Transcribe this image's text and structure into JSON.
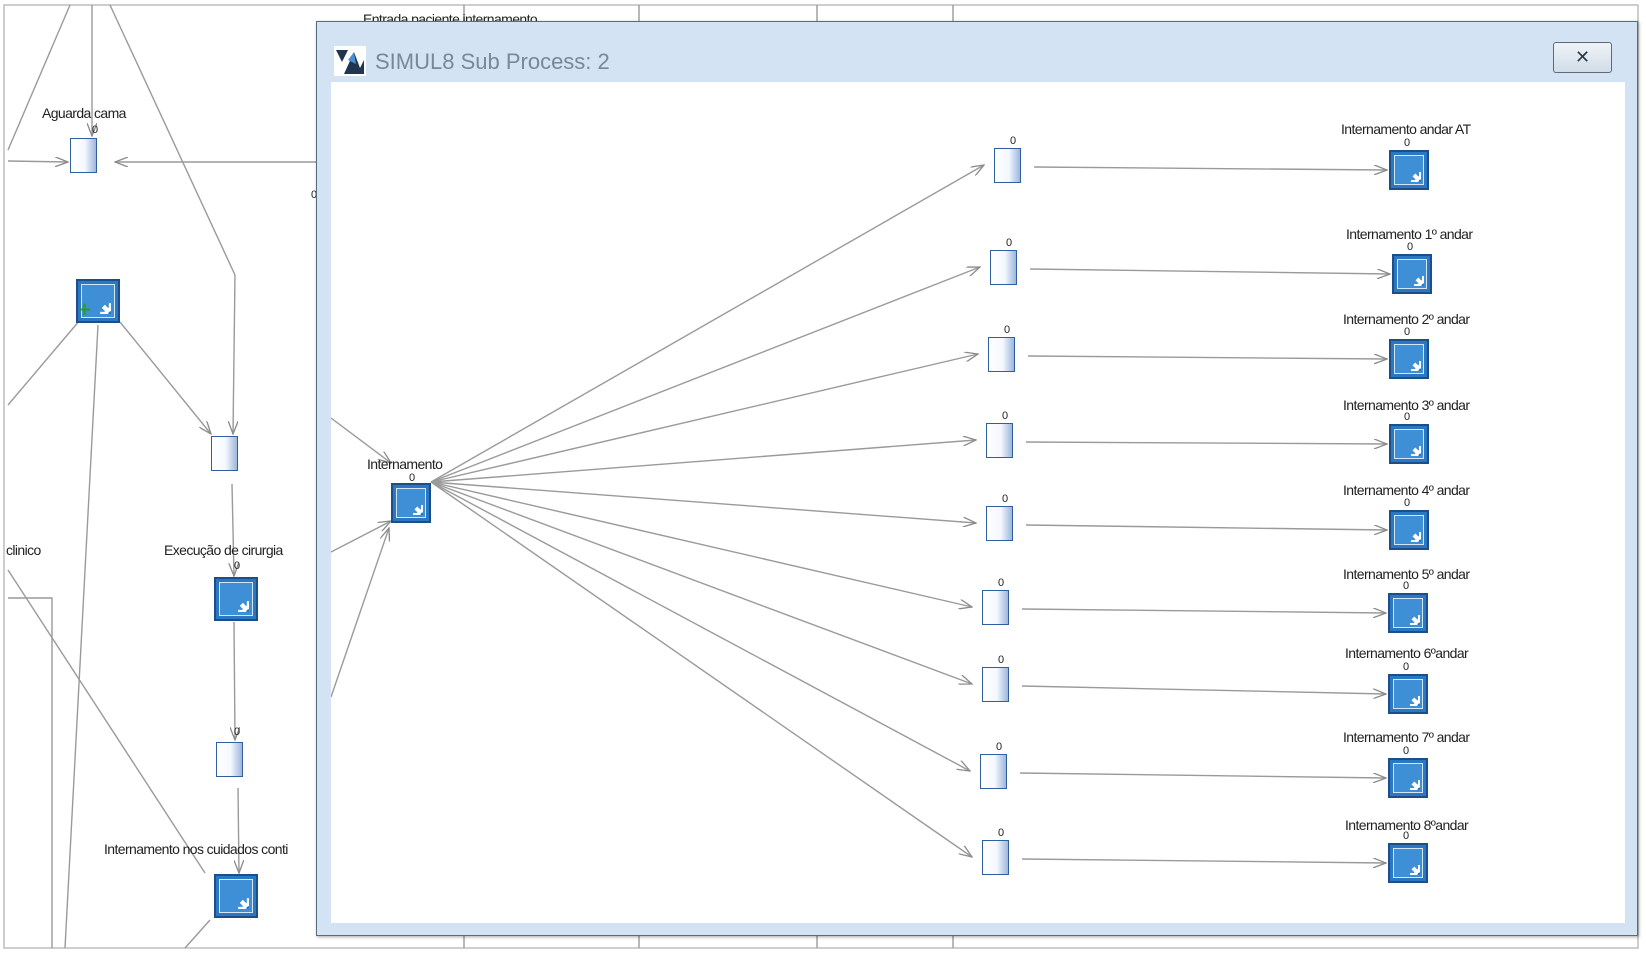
{
  "window": {
    "title": "SIMUL8 Sub Process:  2",
    "close_glyph": "✕"
  },
  "background": {
    "fragment_label": "Entrada paciente internamento",
    "labels": {
      "aguarda_cama": "Aguarda cama",
      "clinico": "clinico",
      "execucao": "Execução de cirurgia",
      "internamento_cuidados": "Internamento nos cuidados conti"
    },
    "counts": {
      "aguarda_cama": "0",
      "execucao": "0",
      "queue_mid": "0",
      "edge": "0"
    },
    "plus_glyph": "+"
  },
  "subprocess": {
    "source": {
      "label": "Internamento",
      "count": "0"
    },
    "queue_counts": [
      "0",
      "0",
      "0",
      "0",
      "0",
      "0",
      "0",
      "0",
      "0"
    ],
    "activities": [
      {
        "label": "Internamento andar AT",
        "count": "0"
      },
      {
        "label": "Internamento 1º andar",
        "count": "0"
      },
      {
        "label": "Internamento 2º andar",
        "count": "0"
      },
      {
        "label": "Internamento 3º andar",
        "count": "0"
      },
      {
        "label": "Internamento 4º andar",
        "count": "0"
      },
      {
        "label": "Internamento 5º andar",
        "count": "0"
      },
      {
        "label": "Internamento 6ºandar",
        "count": "0"
      },
      {
        "label": "Internamento 7º andar",
        "count": "0"
      },
      {
        "label": "Internamento 8ºandar",
        "count": "0"
      }
    ]
  },
  "icons": {
    "activity": "gear-icon",
    "queue": "queue-icon",
    "app": "simul8-logo-icon",
    "close": "close-icon",
    "add": "plus-icon"
  },
  "colors": {
    "activity_fill": "#2b77c2",
    "queue_border": "#2f5f9e",
    "window_frame": "#d3e3f3",
    "connector": "#8a8a8a"
  }
}
